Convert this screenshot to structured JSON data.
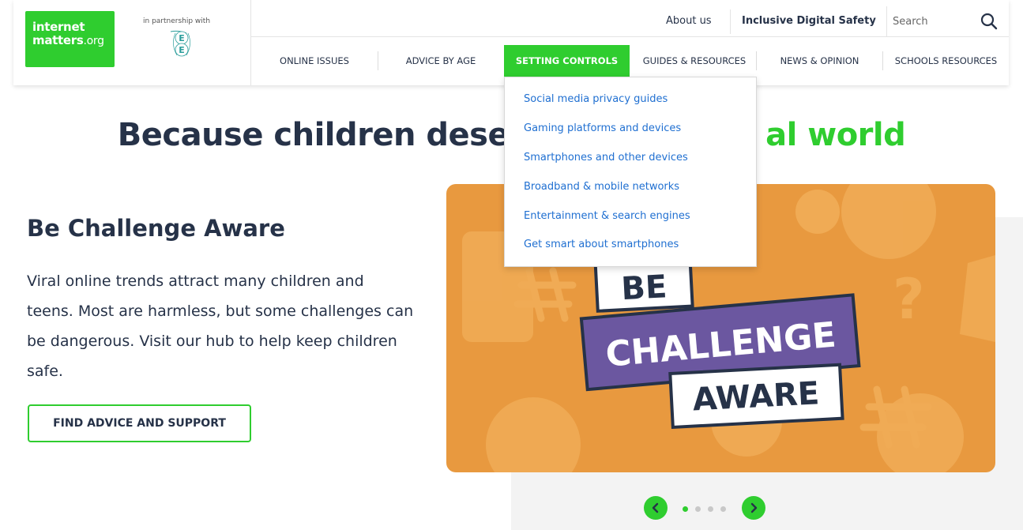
{
  "header": {
    "logo_line1": "internet",
    "logo_line2": "matters",
    "logo_suffix": ".org",
    "partner_text": "in partnership with",
    "partner_logo": "EE",
    "utility": {
      "about": "About us",
      "inclusive": "Inclusive Digital Safety",
      "search_placeholder": "Search"
    },
    "nav": [
      {
        "label": "Online issues",
        "active": false
      },
      {
        "label": "Advice by age",
        "active": false
      },
      {
        "label": "Setting controls",
        "active": true
      },
      {
        "label": "Guides & resources",
        "active": false
      },
      {
        "label": "News & opinion",
        "active": false
      },
      {
        "label": "Schools resources",
        "active": false
      }
    ]
  },
  "dropdown": {
    "items": [
      "Social media privacy guides",
      "Gaming platforms and devices",
      "Smartphones and other devices",
      "Broadband & mobile networks",
      "Entertainment & search engines",
      "Get smart about smartphones"
    ]
  },
  "hero": {
    "headline_start": "Because children dese",
    "headline_end": "al world",
    "title": "Be Challenge Aware",
    "body": "Viral online trends attract many children and teens. Most are harmless, but some challenges can be dangerous. Visit our hub to help keep children safe.",
    "cta": "Find advice and support",
    "image_text": {
      "line1": "BE",
      "line2": "CHALLENGE",
      "line3": "AWARE"
    }
  },
  "carousel": {
    "slide_count": 4,
    "active_index": 0
  },
  "colors": {
    "brand_green": "#2fcd2f",
    "navy": "#263248",
    "link_blue": "#1f6fd1",
    "hero_orange": "#e8993f",
    "badge_purple": "#6b57a0"
  }
}
